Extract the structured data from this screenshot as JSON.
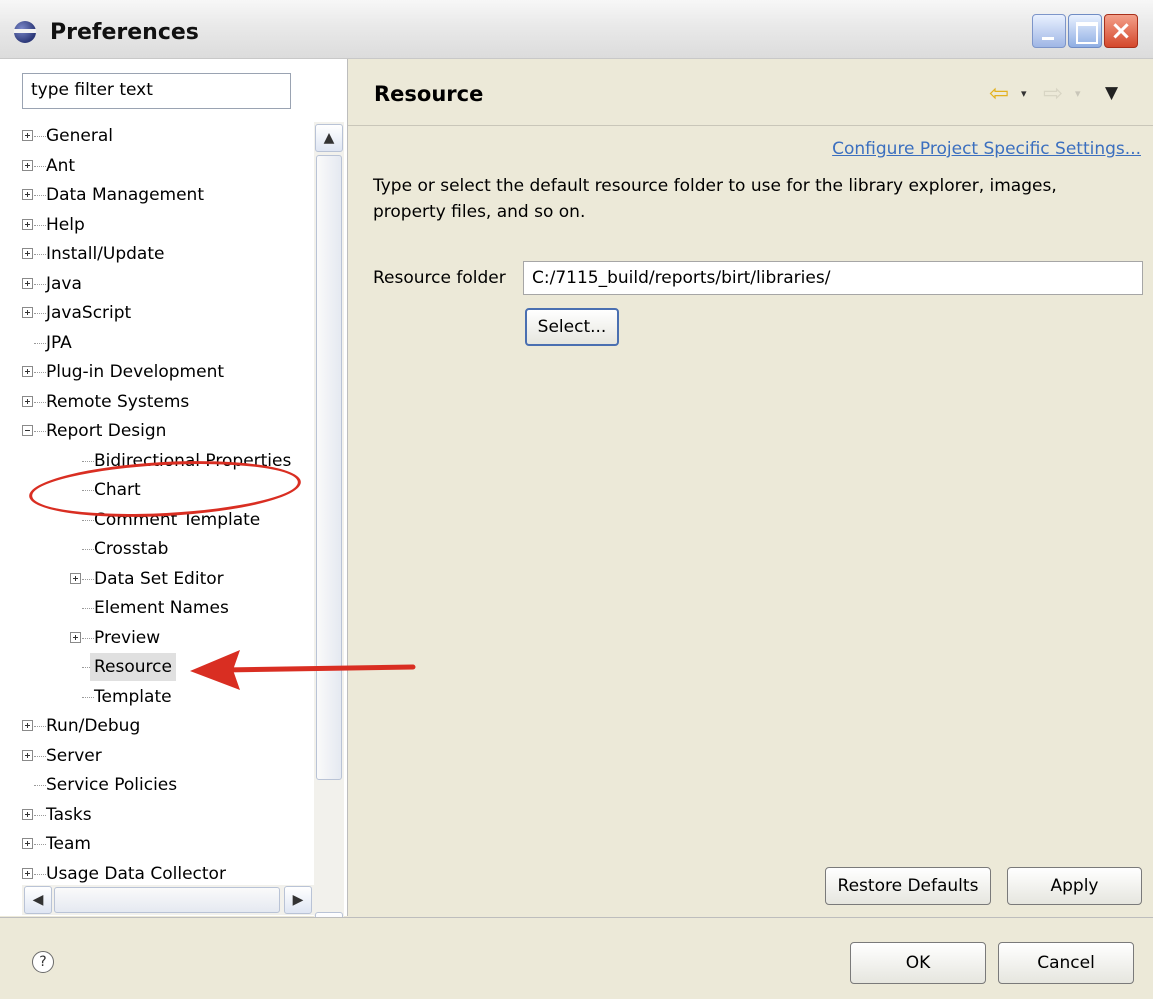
{
  "window": {
    "title": "Preferences"
  },
  "filter": {
    "placeholder": "type filter text"
  },
  "tree": [
    {
      "label": "General",
      "expander": "plus",
      "indent": 0
    },
    {
      "label": "Ant",
      "expander": "plus",
      "indent": 0
    },
    {
      "label": "Data Management",
      "expander": "plus",
      "indent": 0
    },
    {
      "label": "Help",
      "expander": "plus",
      "indent": 0
    },
    {
      "label": "Install/Update",
      "expander": "plus",
      "indent": 0
    },
    {
      "label": "Java",
      "expander": "plus",
      "indent": 0
    },
    {
      "label": "JavaScript",
      "expander": "plus",
      "indent": 0
    },
    {
      "label": "JPA",
      "expander": "none",
      "indent": 0
    },
    {
      "label": "Plug-in Development",
      "expander": "plus",
      "indent": 0
    },
    {
      "label": "Remote Systems",
      "expander": "plus",
      "indent": 0
    },
    {
      "label": "Report Design",
      "expander": "minus",
      "indent": 0
    },
    {
      "label": "Bidirectional Properties",
      "expander": "none",
      "indent": 1
    },
    {
      "label": "Chart",
      "expander": "none",
      "indent": 1
    },
    {
      "label": "Comment Template",
      "expander": "none",
      "indent": 1
    },
    {
      "label": "Crosstab",
      "expander": "none",
      "indent": 1
    },
    {
      "label": "Data Set Editor",
      "expander": "plus",
      "indent": 1
    },
    {
      "label": "Element Names",
      "expander": "none",
      "indent": 1
    },
    {
      "label": "Preview",
      "expander": "plus",
      "indent": 1
    },
    {
      "label": "Resource",
      "expander": "none",
      "indent": 1,
      "selected": true
    },
    {
      "label": "Template",
      "expander": "none",
      "indent": 1
    },
    {
      "label": "Run/Debug",
      "expander": "plus",
      "indent": 0
    },
    {
      "label": "Server",
      "expander": "plus",
      "indent": 0
    },
    {
      "label": "Service Policies",
      "expander": "none",
      "indent": 0
    },
    {
      "label": "Tasks",
      "expander": "plus",
      "indent": 0
    },
    {
      "label": "Team",
      "expander": "plus",
      "indent": 0
    },
    {
      "label": "Usage Data Collector",
      "expander": "plus",
      "indent": 0
    }
  ],
  "page": {
    "title": "Resource",
    "configure_link": "Configure Project Specific Settings...",
    "description": "Type or select the default resource folder to use for the library explorer, images, property files, and so on.",
    "resource_folder_label": "Resource folder",
    "resource_folder_value": "C:/7115_build/reports/birt/libraries/",
    "select_button": "Select...",
    "restore_defaults_button": "Restore Defaults",
    "apply_button": "Apply"
  },
  "footer": {
    "help_icon": "?",
    "ok_button": "OK",
    "cancel_button": "Cancel"
  },
  "icons": {
    "back": "⇦",
    "forward": "⇨",
    "dropdown": "▾",
    "menu": "▼",
    "scroll_up": "▲",
    "scroll_down": "▼",
    "scroll_left": "◀",
    "scroll_right": "▶"
  },
  "colors": {
    "link": "#3b6fbf",
    "annotation": "#d92e22",
    "accent_back_arrow": "#e3b11f"
  }
}
